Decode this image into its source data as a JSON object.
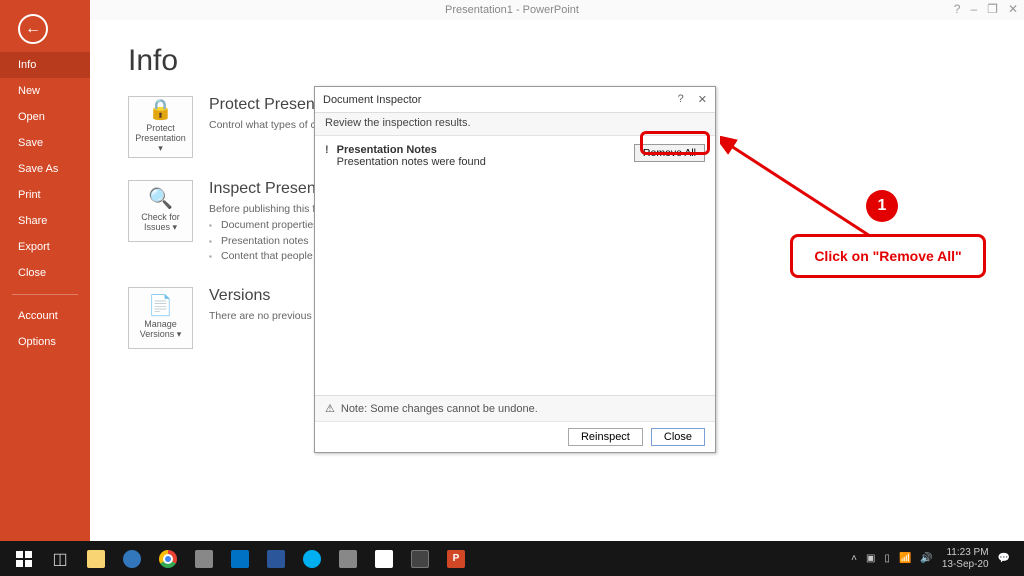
{
  "titlebar": {
    "title": "Presentation1 - PowerPoint",
    "help": "?",
    "minimize": "–",
    "restore": "❐",
    "close": "✕"
  },
  "sidebar": {
    "items": [
      {
        "label": "Info",
        "active": true
      },
      {
        "label": "New"
      },
      {
        "label": "Open"
      },
      {
        "label": "Save"
      },
      {
        "label": "Save As"
      },
      {
        "label": "Print"
      },
      {
        "label": "Share"
      },
      {
        "label": "Export"
      },
      {
        "label": "Close"
      }
    ],
    "footer": [
      {
        "label": "Account"
      },
      {
        "label": "Options"
      }
    ]
  },
  "page": {
    "title": "Info",
    "protect": {
      "tile": "Protect Presentation ▾",
      "heading": "Protect Presentation",
      "desc": "Control what types of changes people can make to this presentation."
    },
    "inspect": {
      "tile": "Check for Issues ▾",
      "heading": "Inspect Presentation",
      "desc": "Before publishing this file, be aware that it contains:",
      "b1": "Document properties",
      "b2": "Presentation notes",
      "b3": "Content that people with disabilities are unable to read"
    },
    "versions": {
      "tile": "Manage Versions ▾",
      "heading": "Versions",
      "desc": "There are no previous versions of this file."
    }
  },
  "dialog": {
    "title": "Document Inspector",
    "help": "?",
    "close_x": "✕",
    "subheader": "Review the inspection results.",
    "result_icon": "!",
    "result_title": "Presentation Notes",
    "result_desc": "Presentation notes were found",
    "remove_all": "Remove All",
    "note_icon": "⚠",
    "note": "Note: Some changes cannot be undone.",
    "reinspect": "Reinspect",
    "close": "Close"
  },
  "callout": {
    "num": "1",
    "text": "Click on \"Remove All\""
  },
  "taskbar": {
    "time": "11:23 PM",
    "date": "13-Sep-20"
  }
}
